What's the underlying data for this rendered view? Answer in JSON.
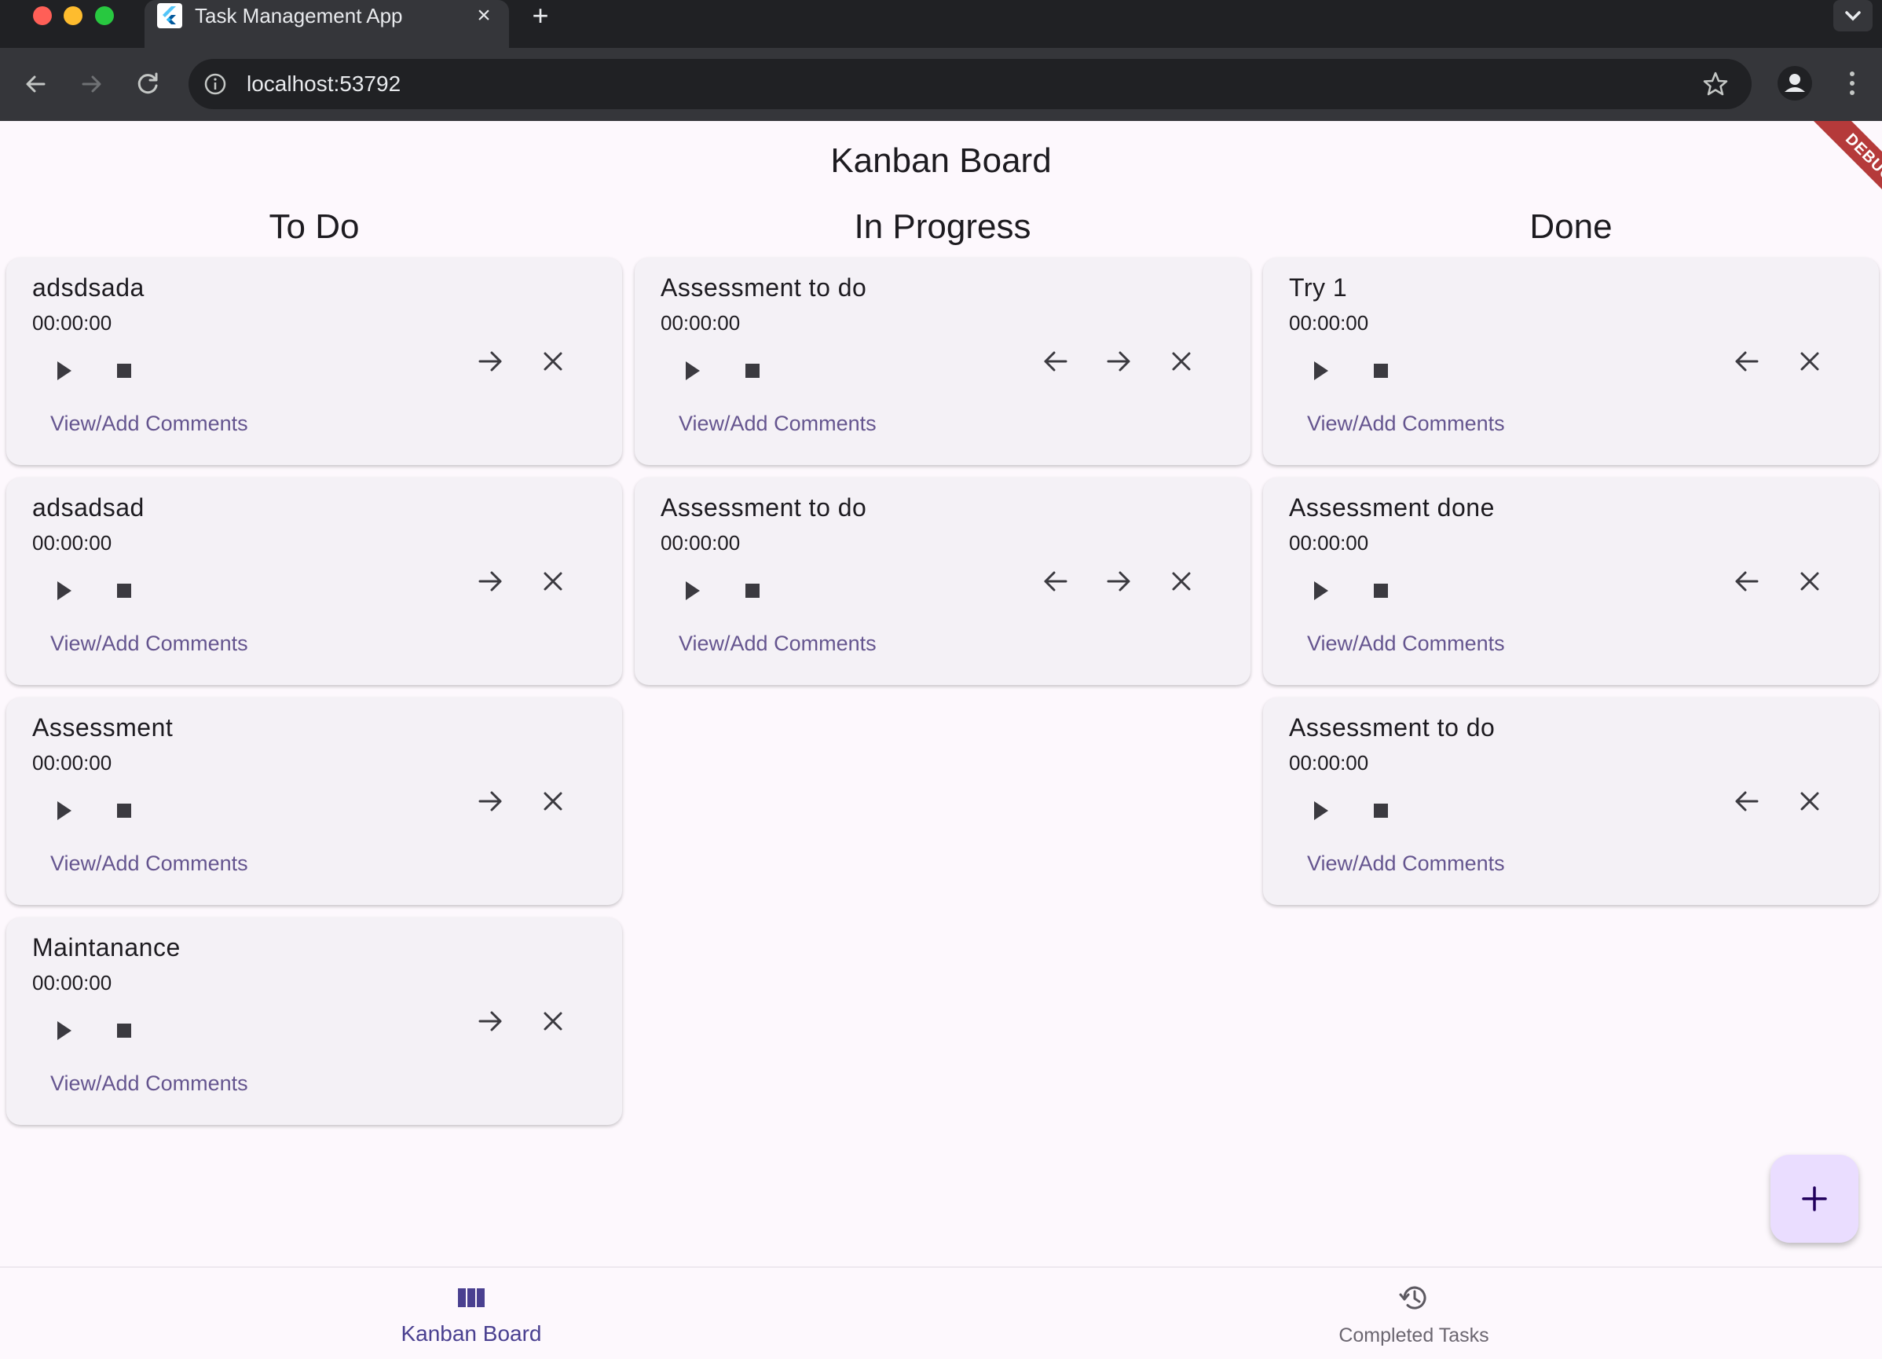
{
  "browser": {
    "tab_title": "Task Management App",
    "url": "localhost:53792",
    "new_tab_symbol": "+",
    "close_symbol": "×"
  },
  "app": {
    "title": "Kanban Board",
    "debug_banner": "DEBUG",
    "card_comments_label": "View/Add Comments",
    "accent_color": "#65558f"
  },
  "columns": [
    {
      "title": "To Do",
      "actions": [
        "arrow-forward-icon",
        "close-icon"
      ],
      "tasks": [
        {
          "title": "adsdsada",
          "timer": "00:00:00",
          "comments": "View/Add Comments"
        },
        {
          "title": "adsadsad",
          "timer": "00:00:00",
          "comments": "View/Add Comments"
        },
        {
          "title": "Assessment",
          "timer": "00:00:00",
          "comments": "View/Add Comments"
        },
        {
          "title": "Maintanance",
          "timer": "00:00:00",
          "comments": "View/Add Comments"
        }
      ]
    },
    {
      "title": "In Progress",
      "actions": [
        "arrow-back-icon",
        "arrow-forward-icon",
        "close-icon"
      ],
      "tasks": [
        {
          "title": "Assessment to do",
          "timer": "00:00:00",
          "comments": "View/Add Comments"
        },
        {
          "title": "Assessment to do",
          "timer": "00:00:00",
          "comments": "View/Add Comments"
        }
      ]
    },
    {
      "title": "Done",
      "actions": [
        "arrow-back-icon",
        "close-icon"
      ],
      "tasks": [
        {
          "title": "Try 1",
          "timer": "00:00:00",
          "comments": "View/Add Comments"
        },
        {
          "title": "Assessment done",
          "timer": "00:00:00",
          "comments": "View/Add Comments"
        },
        {
          "title": "Assessment to do",
          "timer": "00:00:00",
          "comments": "View/Add Comments"
        }
      ]
    }
  ],
  "bottom_nav": {
    "items": [
      {
        "label": "Kanban Board",
        "icon": "view-column-icon",
        "active": true
      },
      {
        "label": "Completed Tasks",
        "icon": "history-icon",
        "active": false
      }
    ]
  },
  "fab": {
    "icon": "add-icon"
  }
}
